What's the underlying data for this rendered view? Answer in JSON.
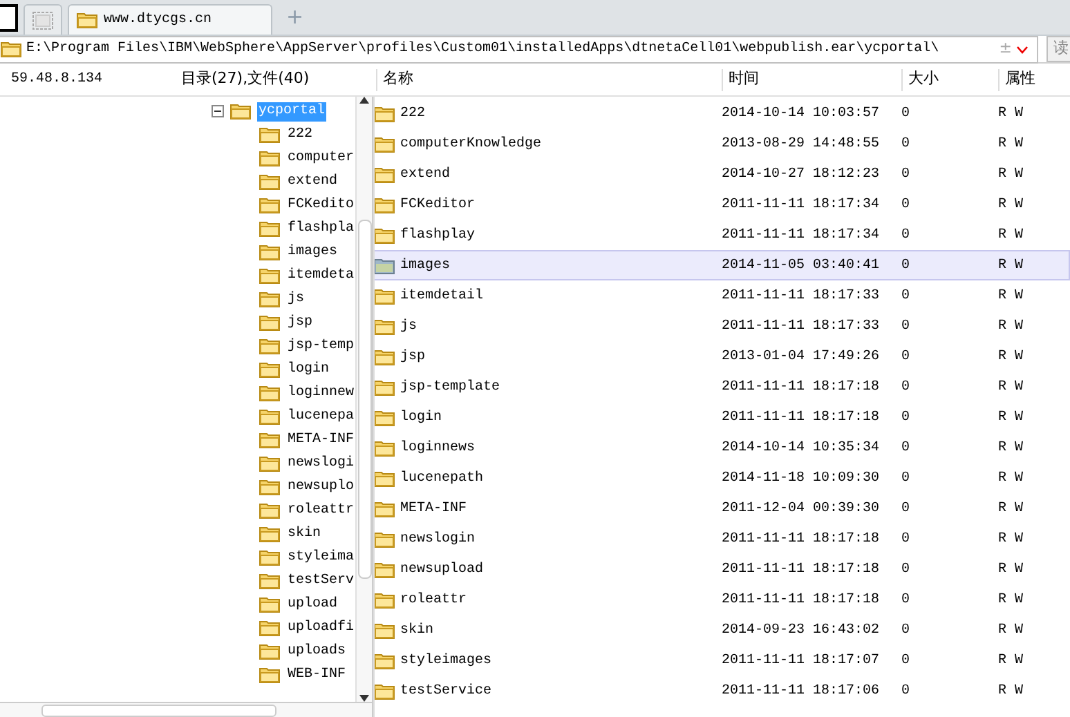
{
  "tabs": [
    {
      "kind": "blank",
      "selected": false
    },
    {
      "kind": "folder",
      "label": "www.dtycgs.cn",
      "selected": true
    }
  ],
  "new_tab": "+",
  "address": {
    "value": "E:\\Program Files\\IBM\\WebSphere\\AppServer\\profiles\\Custom01\\installedApps\\dtnetaCell01\\webpublish.ear\\ycportal\\",
    "toggle": "±",
    "button": "读"
  },
  "host": "59.48.8.134",
  "summary": "目录(27),文件(40)",
  "tree": {
    "label": "ycportal",
    "expanded": true,
    "selected": true,
    "children": [
      {
        "label": "222"
      },
      {
        "label": "computer"
      },
      {
        "label": "extend"
      },
      {
        "label": "FCKedito"
      },
      {
        "label": "flashpla"
      },
      {
        "label": "images"
      },
      {
        "label": "itemdeta"
      },
      {
        "label": "js"
      },
      {
        "label": "jsp"
      },
      {
        "label": "jsp-temp"
      },
      {
        "label": "login"
      },
      {
        "label": "loginnew"
      },
      {
        "label": "lucenepa"
      },
      {
        "label": "META-INF"
      },
      {
        "label": "newslogi"
      },
      {
        "label": "newsuplo"
      },
      {
        "label": "roleattr"
      },
      {
        "label": "skin"
      },
      {
        "label": "styleima"
      },
      {
        "label": "testServ"
      },
      {
        "label": "upload"
      },
      {
        "label": "uploadfi"
      },
      {
        "label": "uploads"
      },
      {
        "label": "WEB-INF"
      }
    ]
  },
  "table": {
    "columns": [
      "名称",
      "时间",
      "大小",
      "属性"
    ],
    "rows": [
      {
        "name": "222",
        "time": "2014-10-14 10:03:57",
        "size": "0",
        "attr": "R W",
        "selected": false
      },
      {
        "name": "computerKnowledge",
        "time": "2013-08-29 14:48:55",
        "size": "0",
        "attr": "R W",
        "selected": false
      },
      {
        "name": "extend",
        "time": "2014-10-27 18:12:23",
        "size": "0",
        "attr": "R W",
        "selected": false
      },
      {
        "name": "FCKeditor",
        "time": "2011-11-11 18:17:34",
        "size": "0",
        "attr": "R W",
        "selected": false
      },
      {
        "name": "flashplay",
        "time": "2011-11-11 18:17:34",
        "size": "0",
        "attr": "R W",
        "selected": false
      },
      {
        "name": "images",
        "time": "2014-11-05 03:40:41",
        "size": "0",
        "attr": "R W",
        "selected": true
      },
      {
        "name": "itemdetail",
        "time": "2011-11-11 18:17:33",
        "size": "0",
        "attr": "R W",
        "selected": false
      },
      {
        "name": "js",
        "time": "2011-11-11 18:17:33",
        "size": "0",
        "attr": "R W",
        "selected": false
      },
      {
        "name": "jsp",
        "time": "2013-01-04 17:49:26",
        "size": "0",
        "attr": "R W",
        "selected": false
      },
      {
        "name": "jsp-template",
        "time": "2011-11-11 18:17:18",
        "size": "0",
        "attr": "R W",
        "selected": false
      },
      {
        "name": "login",
        "time": "2011-11-11 18:17:18",
        "size": "0",
        "attr": "R W",
        "selected": false
      },
      {
        "name": "loginnews",
        "time": "2014-10-14 10:35:34",
        "size": "0",
        "attr": "R W",
        "selected": false
      },
      {
        "name": "lucenepath",
        "time": "2014-11-18 10:09:30",
        "size": "0",
        "attr": "R W",
        "selected": false
      },
      {
        "name": "META-INF",
        "time": "2011-12-04 00:39:30",
        "size": "0",
        "attr": "R W",
        "selected": false
      },
      {
        "name": "newslogin",
        "time": "2011-11-11 18:17:18",
        "size": "0",
        "attr": "R W",
        "selected": false
      },
      {
        "name": "newsupload",
        "time": "2011-11-11 18:17:18",
        "size": "0",
        "attr": "R W",
        "selected": false
      },
      {
        "name": "roleattr",
        "time": "2011-11-11 18:17:18",
        "size": "0",
        "attr": "R W",
        "selected": false
      },
      {
        "name": "skin",
        "time": "2014-09-23 16:43:02",
        "size": "0",
        "attr": "R W",
        "selected": false
      },
      {
        "name": "styleimages",
        "time": "2011-11-11 18:17:07",
        "size": "0",
        "attr": "R W",
        "selected": false
      },
      {
        "name": "testService",
        "time": "2011-11-11 18:17:06",
        "size": "0",
        "attr": "R W",
        "selected": false
      }
    ]
  }
}
